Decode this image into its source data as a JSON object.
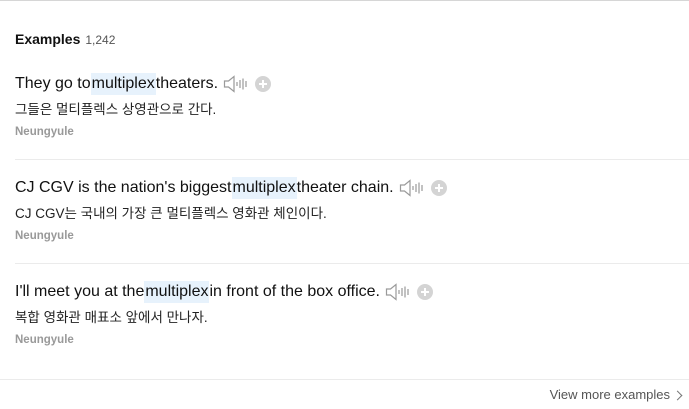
{
  "header": {
    "title": "Examples",
    "count": "1,242"
  },
  "examples": [
    {
      "before": "They go to ",
      "highlight": "multiplex",
      "after": " theaters.",
      "translation": "그들은 멀티플렉스 상영관으로 간다.",
      "source": "Neungyule"
    },
    {
      "before": "CJ CGV is the nation's biggest ",
      "highlight": "multiplex",
      "after": " theater chain.",
      "translation": "CJ CGV는 국내의 가장 큰 멀티플렉스 영화관 체인이다.",
      "source": "Neungyule"
    },
    {
      "before": "I'll meet you at the ",
      "highlight": "multiplex",
      "after": " in front of the box office.",
      "translation": "복합 영화관 매표소 앞에서 만나자.",
      "source": "Neungyule"
    }
  ],
  "footer": {
    "more_label": "View more examples"
  },
  "icons": {
    "speaker": "speaker-icon",
    "add": "plus-circle-icon",
    "more": "chevron-right-icon"
  },
  "colors": {
    "highlight": "#e7f2fc",
    "icon_gray": "#d4d4d4"
  }
}
